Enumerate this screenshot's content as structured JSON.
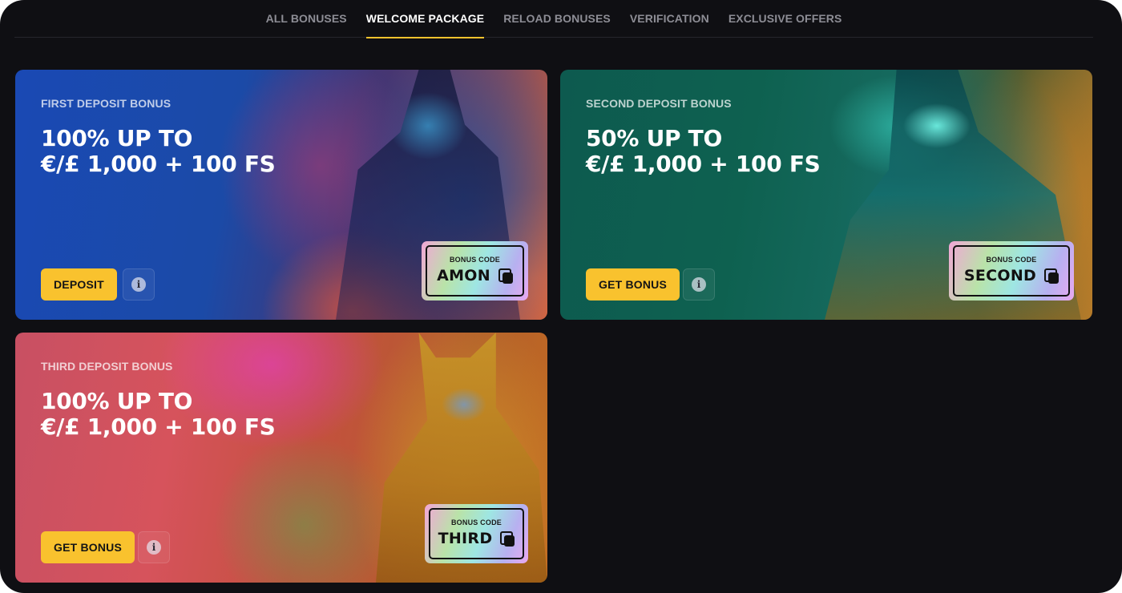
{
  "tabs": [
    {
      "label": "ALL BONUSES",
      "active": false
    },
    {
      "label": "WELCOME PACKAGE",
      "active": true
    },
    {
      "label": "RELOAD BONUSES",
      "active": false
    },
    {
      "label": "VERIFICATION",
      "active": false
    },
    {
      "label": "EXCLUSIVE OFFERS",
      "active": false
    }
  ],
  "accent_color": "#f9c22e",
  "cards": [
    {
      "label": "FIRST DEPOSIT BONUS",
      "title_line1": "100% UP TO",
      "title_line2": "€/£ 1,000 + 100 FS",
      "button_label": "DEPOSIT",
      "code_caption": "BONUS CODE",
      "code": "AMON",
      "info_icon": "info-icon",
      "copy_icon": "copy-icon"
    },
    {
      "label": "SECOND DEPOSIT BONUS",
      "title_line1": "50% UP TO",
      "title_line2": "€/£ 1,000 + 100 FS",
      "button_label": "GET BONUS",
      "code_caption": "BONUS CODE",
      "code": "SECOND",
      "info_icon": "info-icon",
      "copy_icon": "copy-icon"
    },
    {
      "label": "THIRD DEPOSIT BONUS",
      "title_line1": "100% UP TO",
      "title_line2": "€/£ 1,000 + 100 FS",
      "button_label": "GET BONUS",
      "code_caption": "BONUS CODE",
      "code": "THIRD",
      "info_icon": "info-icon",
      "copy_icon": "copy-icon"
    }
  ]
}
